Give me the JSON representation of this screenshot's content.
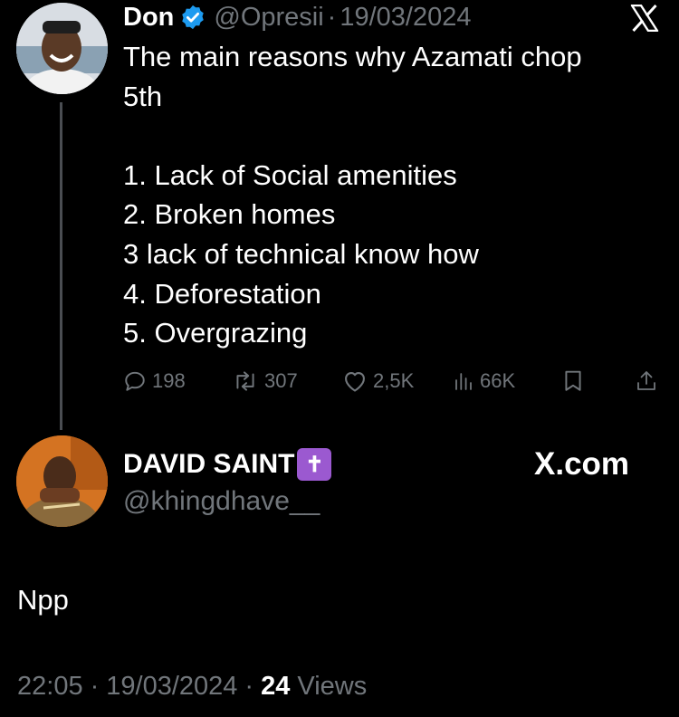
{
  "tweet": {
    "author_name": "Don",
    "handle": "@Opresii",
    "separator": "·",
    "date": "19/03/2024",
    "text": "The main reasons why Azamati chop\n5th\n\n1. Lack of Social amenities\n2. Broken homes\n3  lack of technical know how\n4. Deforestation\n5. Overgrazing",
    "actions": {
      "replies": "198",
      "reposts": "307",
      "likes": "2,5K",
      "views": "66K"
    }
  },
  "reply": {
    "author_name": "DAVID SAINT",
    "name_emoji": "✝",
    "handle": "@khingdhave__",
    "brand": "X.com",
    "text": "Npp",
    "time": "22:05",
    "sep1": "·",
    "date": "19/03/2024",
    "sep2": "·",
    "views_count": "24",
    "views_label": "Views"
  },
  "icons": {
    "x_logo": "x-logo-icon",
    "verified": "verified-badge-icon",
    "reply": "reply-icon",
    "repost": "repost-icon",
    "like": "heart-icon",
    "views": "views-chart-icon",
    "bookmark": "bookmark-icon",
    "share": "share-icon"
  },
  "colors": {
    "background": "#000000",
    "text": "#ffffff",
    "muted": "#71767b",
    "verified": "#1d9bf0",
    "emoji_purple": "#9b59d0"
  }
}
